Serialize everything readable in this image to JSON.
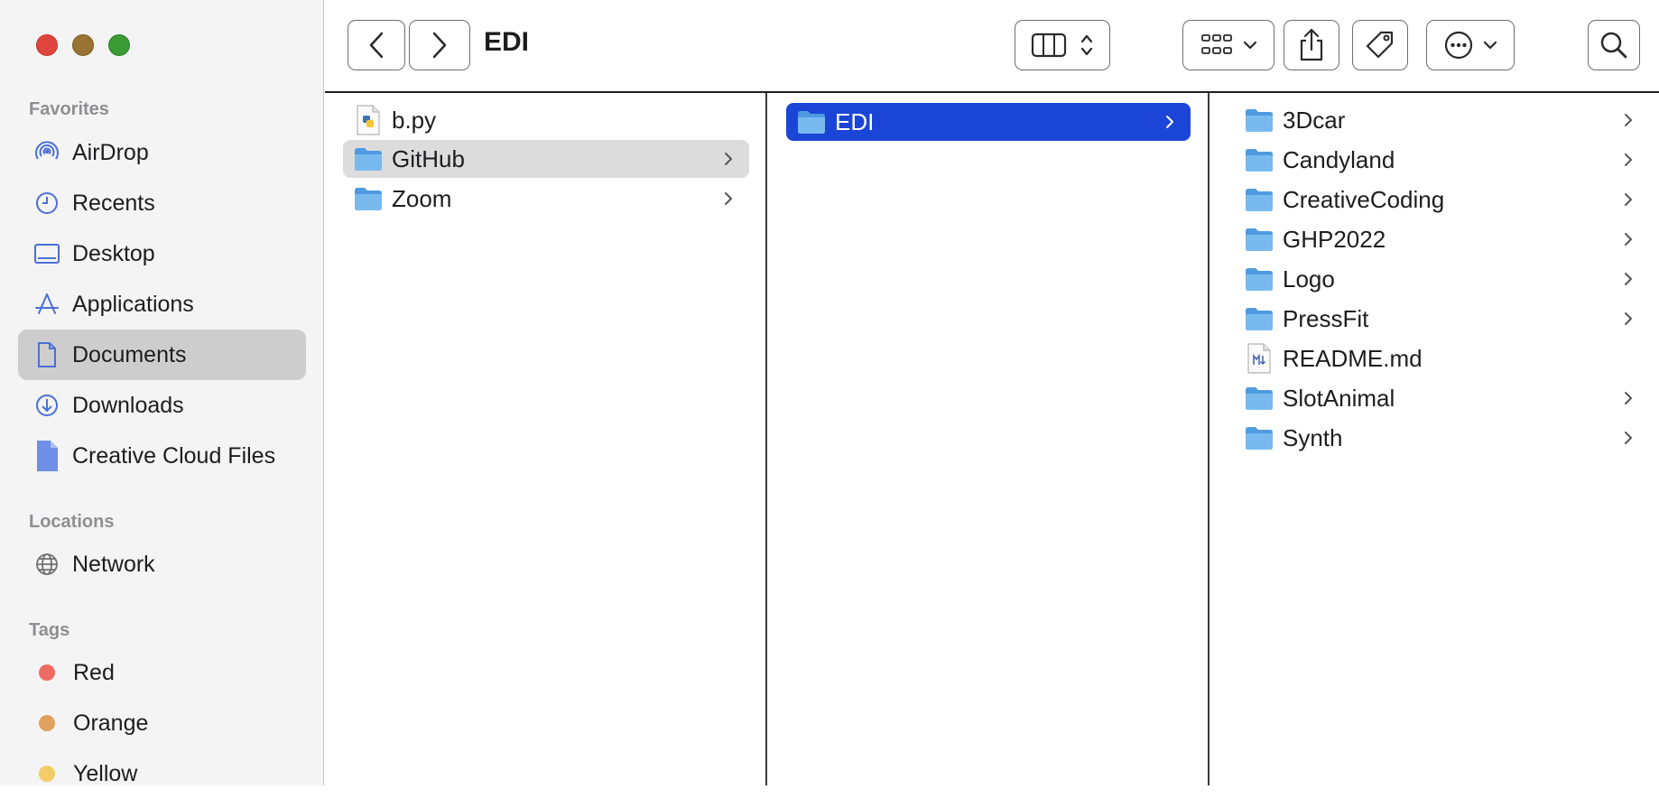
{
  "window": {
    "title": "EDI"
  },
  "sidebar": {
    "favorites_title": "Favorites",
    "favorites": [
      {
        "label": "AirDrop",
        "icon": "airdrop-icon"
      },
      {
        "label": "Recents",
        "icon": "clock-icon"
      },
      {
        "label": "Desktop",
        "icon": "desktop-icon"
      },
      {
        "label": "Applications",
        "icon": "applications-icon"
      },
      {
        "label": "Documents",
        "icon": "document-icon",
        "selected": true
      },
      {
        "label": "Downloads",
        "icon": "download-icon"
      },
      {
        "label": "Creative Cloud Files",
        "icon": "file-icon"
      }
    ],
    "locations_title": "Locations",
    "locations": [
      {
        "label": "Network",
        "icon": "globe-icon"
      }
    ],
    "tags_title": "Tags",
    "tags": [
      {
        "label": "Red",
        "color": "#ee6b62"
      },
      {
        "label": "Orange",
        "color": "#e0a15e"
      },
      {
        "label": "Yellow",
        "color": "#f2cc66"
      }
    ]
  },
  "columns": [
    {
      "items": [
        {
          "name": "b.py",
          "kind": "python-file-icon",
          "chevron": false
        },
        {
          "name": "GitHub",
          "kind": "folder-icon",
          "chevron": true,
          "state": "parent-selected"
        },
        {
          "name": "Zoom",
          "kind": "folder-icon",
          "chevron": true
        }
      ]
    },
    {
      "items": [
        {
          "name": "EDI",
          "kind": "folder-icon",
          "chevron": true,
          "state": "selected"
        }
      ]
    },
    {
      "items": [
        {
          "name": "3Dcar",
          "kind": "folder-icon",
          "chevron": true
        },
        {
          "name": "Candyland",
          "kind": "folder-icon",
          "chevron": true
        },
        {
          "name": "CreativeCoding",
          "kind": "folder-icon",
          "chevron": true
        },
        {
          "name": "GHP2022",
          "kind": "folder-icon",
          "chevron": true
        },
        {
          "name": "Logo",
          "kind": "folder-icon",
          "chevron": true
        },
        {
          "name": "PressFit",
          "kind": "folder-icon",
          "chevron": true
        },
        {
          "name": "README.md",
          "kind": "markdown-file-icon",
          "chevron": false
        },
        {
          "name": "SlotAnimal",
          "kind": "folder-icon",
          "chevron": true
        },
        {
          "name": "Synth",
          "kind": "folder-icon",
          "chevron": true
        }
      ]
    }
  ],
  "colors": {
    "selection": "#1b45d6",
    "folder": "#6fb4ea",
    "sidebar_icon": "#4a6fd6"
  }
}
